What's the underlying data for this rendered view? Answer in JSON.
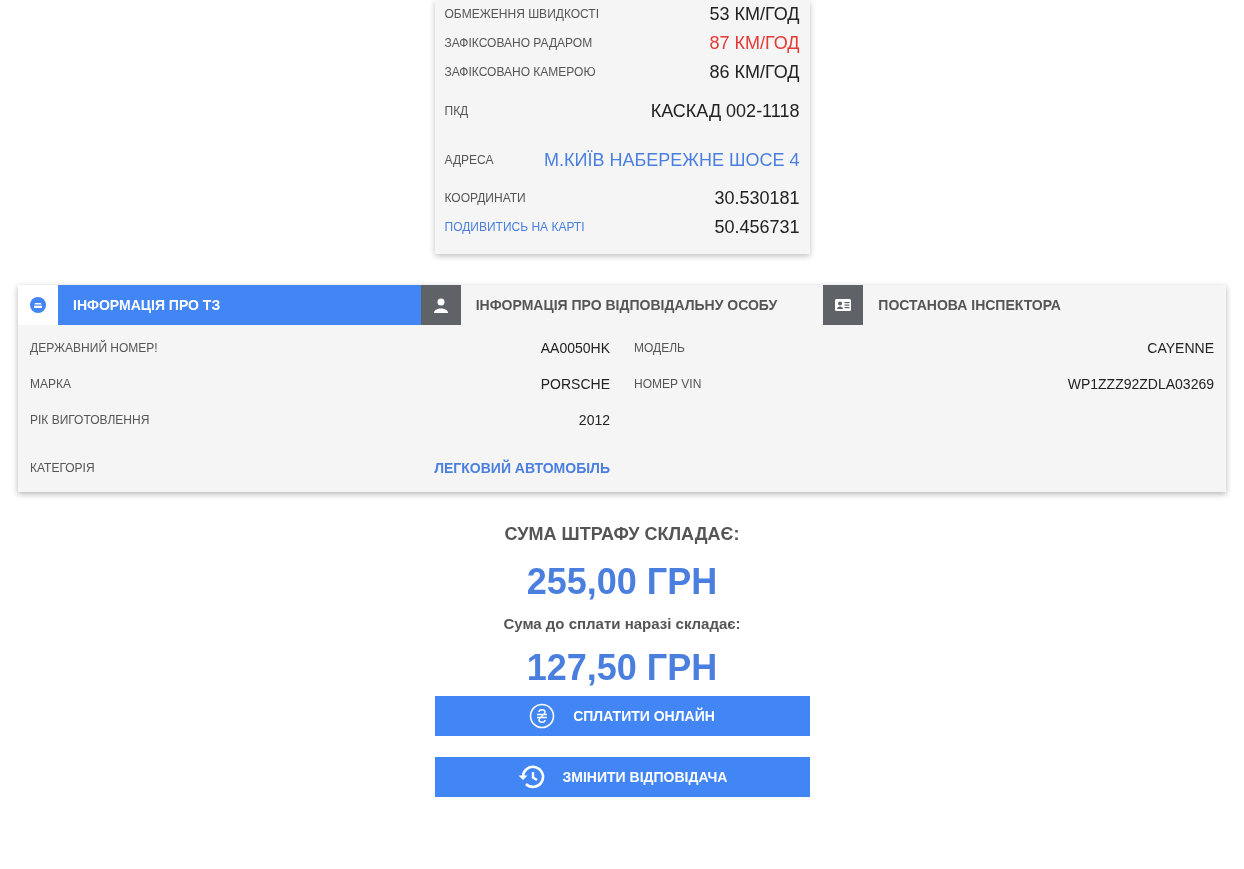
{
  "speed_card": {
    "rows": [
      {
        "label": "ОБМЕЖЕННЯ ШВИДКОСТІ",
        "value": "53 КМ/ГОД",
        "kind": "plain"
      },
      {
        "label": "ЗАФІКСОВАНО РАДАРОМ",
        "value": "87 КМ/ГОД",
        "kind": "alert"
      },
      {
        "label": "ЗАФІКСОВАНО КАМЕРОЮ",
        "value": "86 КМ/ГОД",
        "kind": "plain"
      },
      {
        "label": "ПКД",
        "value": "КАСКАД 002-1118",
        "kind": "plain"
      },
      {
        "label": "АДРЕСА",
        "value": "М.КИЇВ НАБЕРЕЖНЕ ШОСЕ 4",
        "kind": "address"
      },
      {
        "label": "КООРДИНАТИ",
        "value": "30.530181",
        "kind": "plain"
      },
      {
        "label": "ПОДИВИТИСЬ НА КАРТІ",
        "value": "50.456731",
        "kind": "map"
      }
    ]
  },
  "tabs": [
    {
      "label": "ІНФОРМАЦІЯ ПРО ТЗ",
      "selected": true
    },
    {
      "label": "ІНФОРМАЦІЯ ПРО ВІДПОВІДАЛЬНУ ОСОБУ",
      "selected": false
    },
    {
      "label": "ПОСТАНОВА ІНСПЕКТОРА",
      "selected": false
    }
  ],
  "vehicle": {
    "left": [
      {
        "label": "ДЕРЖАВНИЙ НОМЕР!",
        "value": "AA0050HK",
        "kind": "plain"
      },
      {
        "label": "МАРКА",
        "value": "PORSCHE",
        "kind": "plain"
      },
      {
        "label": "РІК ВИГОТОВЛЕННЯ",
        "value": "2012",
        "kind": "plain"
      },
      {
        "label": "КАТЕГОРІЯ",
        "value": "ЛЕГКОВИЙ АВТОМОБІЛЬ",
        "kind": "category"
      }
    ],
    "right": [
      {
        "label": "МОДЕЛЬ",
        "value": "CAYENNE",
        "kind": "plain"
      },
      {
        "label": "НОМЕР VIN",
        "value": "WP1ZZZ92ZDLA03269",
        "kind": "plain"
      }
    ]
  },
  "fine": {
    "title": "СУМА ШТРАФУ СКЛАДАЄ:",
    "amount": "255,00 ГРН",
    "due_label": "Сума до сплати наразі складає:",
    "due_amount": "127,50 ГРН"
  },
  "buttons": [
    {
      "label": "СПЛАТИТИ ОНЛАЙН"
    },
    {
      "label": "ЗМІНИТИ ВІДПОВІДАЧА"
    }
  ]
}
